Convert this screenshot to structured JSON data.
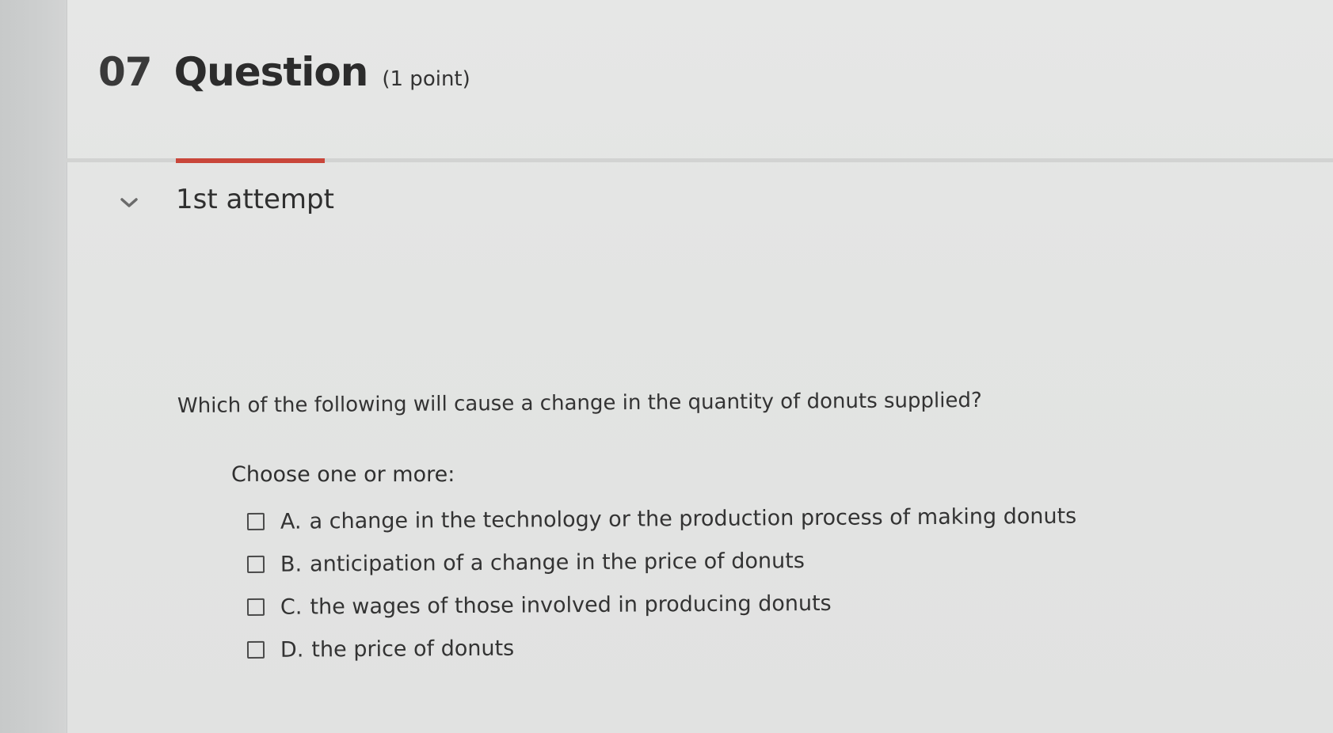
{
  "question": {
    "number": "07",
    "title": "Question",
    "points": "(1 point)"
  },
  "attempt": {
    "label": "1st attempt"
  },
  "prompt": "Which of the following will cause a change in the quantity of donuts supplied?",
  "choose_label": "Choose one or more:",
  "options": [
    {
      "letter": "A.",
      "text": "a change in the technology or the production process of making donuts",
      "checked": false
    },
    {
      "letter": "B.",
      "text": "anticipation of a change in the price of donuts",
      "checked": false
    },
    {
      "letter": "C.",
      "text": "the wages of those involved in producing donuts",
      "checked": false
    },
    {
      "letter": "D.",
      "text": "the price of donuts",
      "checked": false
    }
  ],
  "colors": {
    "accent": "#c9463a",
    "text": "#333333",
    "background": "#e4e5e4"
  },
  "icons": {
    "attempt_toggle": "chevron-down-icon",
    "option_box": "checkbox-empty-icon"
  }
}
